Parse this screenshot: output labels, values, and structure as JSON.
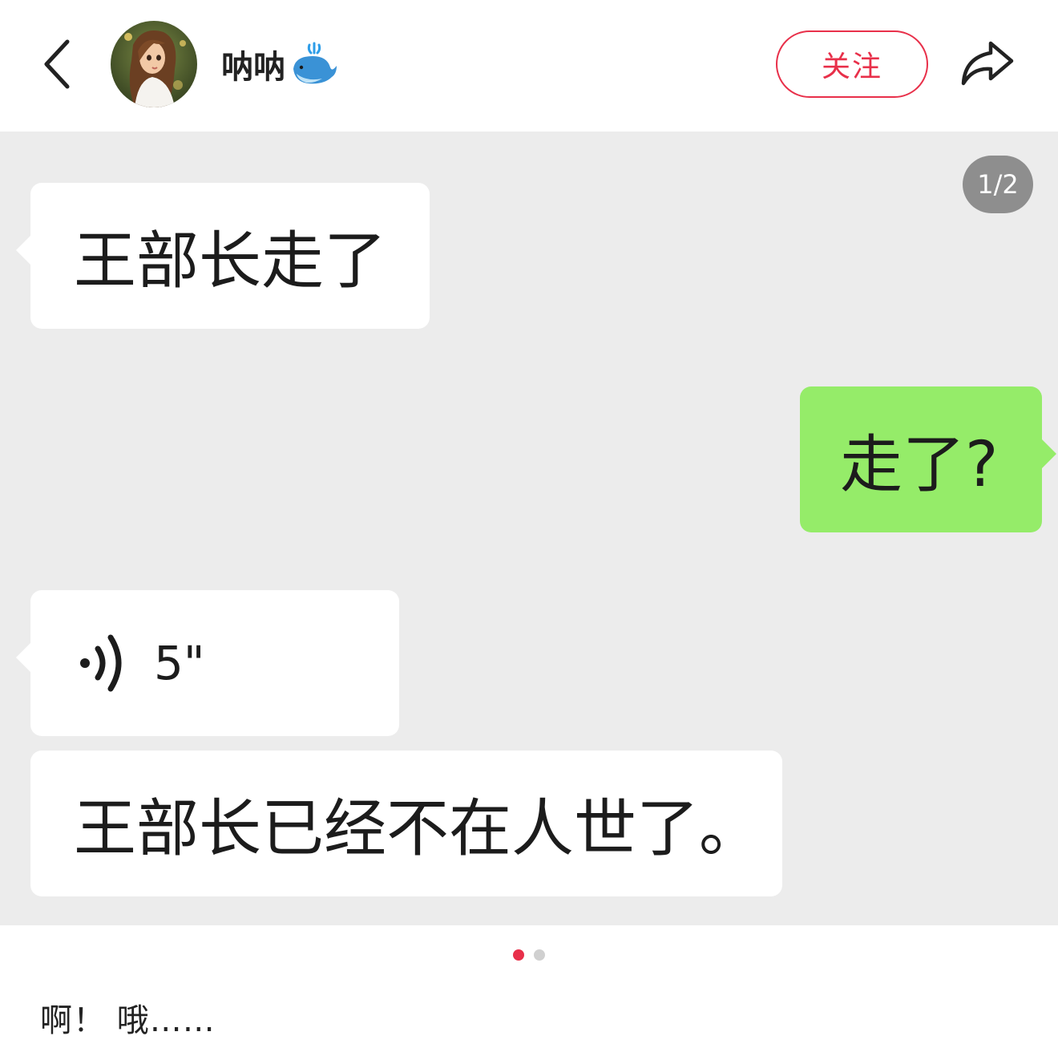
{
  "header": {
    "username": "呐呐",
    "follow_label": "关注"
  },
  "image_viewer": {
    "page_counter": "1/2",
    "total_pages": 2,
    "current_page": 1,
    "messages": [
      {
        "side": "left",
        "type": "text",
        "text": "王部长走了"
      },
      {
        "side": "right",
        "type": "text",
        "text": "走了?"
      },
      {
        "side": "left",
        "type": "voice",
        "duration": "5\""
      },
      {
        "side": "left",
        "type": "text",
        "text": "王部长已经不在人世了。"
      }
    ]
  },
  "post": {
    "caption": "啊！ 哦……"
  },
  "colors": {
    "accent": "#e8304a",
    "chat_bg": "#ececec",
    "sent_bubble": "#95ec69",
    "received_bubble": "#ffffff"
  },
  "icons": [
    "back-icon",
    "avatar",
    "whale-emoji",
    "share-icon",
    "voice-icon"
  ]
}
